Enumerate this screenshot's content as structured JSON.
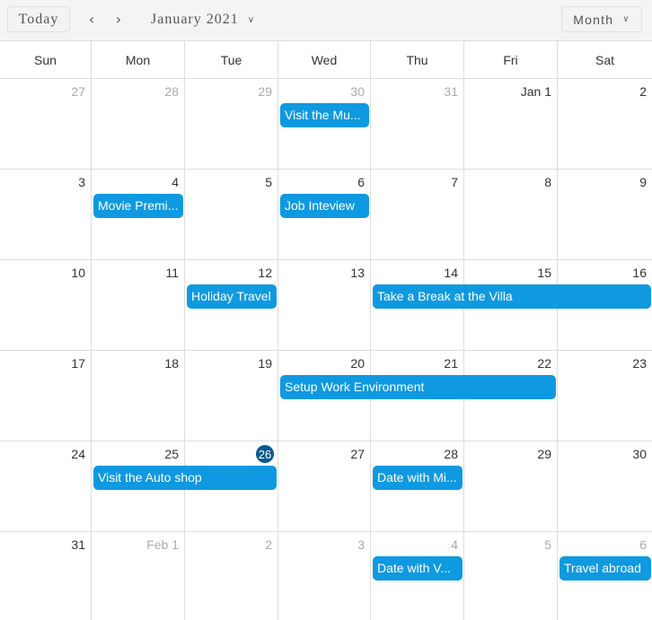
{
  "toolbar": {
    "today_label": "Today",
    "prev_icon": "‹",
    "next_icon": "›",
    "period_label": "January 2021",
    "view_label": "Month",
    "chevron_icon": "⌄"
  },
  "weekdays": [
    "Sun",
    "Mon",
    "Tue",
    "Wed",
    "Thu",
    "Fri",
    "Sat"
  ],
  "weeks": [
    [
      {
        "label": "27",
        "other": true
      },
      {
        "label": "28",
        "other": true
      },
      {
        "label": "29",
        "other": true
      },
      {
        "label": "30",
        "other": true
      },
      {
        "label": "31",
        "other": true
      },
      {
        "label": "Jan 1"
      },
      {
        "label": "2"
      }
    ],
    [
      {
        "label": "3"
      },
      {
        "label": "4"
      },
      {
        "label": "5"
      },
      {
        "label": "6"
      },
      {
        "label": "7"
      },
      {
        "label": "8"
      },
      {
        "label": "9"
      }
    ],
    [
      {
        "label": "10"
      },
      {
        "label": "11"
      },
      {
        "label": "12"
      },
      {
        "label": "13"
      },
      {
        "label": "14"
      },
      {
        "label": "15"
      },
      {
        "label": "16"
      }
    ],
    [
      {
        "label": "17"
      },
      {
        "label": "18"
      },
      {
        "label": "19"
      },
      {
        "label": "20"
      },
      {
        "label": "21"
      },
      {
        "label": "22"
      },
      {
        "label": "23"
      }
    ],
    [
      {
        "label": "24"
      },
      {
        "label": "25"
      },
      {
        "label": "26",
        "today": true
      },
      {
        "label": "27"
      },
      {
        "label": "28"
      },
      {
        "label": "29"
      },
      {
        "label": "30"
      }
    ],
    [
      {
        "label": "31"
      },
      {
        "label": "Feb 1",
        "other": true
      },
      {
        "label": "2",
        "other": true
      },
      {
        "label": "3",
        "other": true
      },
      {
        "label": "4",
        "other": true
      },
      {
        "label": "5",
        "other": true
      },
      {
        "label": "6",
        "other": true
      }
    ]
  ],
  "events": [
    {
      "title": "Visit the Museum",
      "display": "Visit the Mu...",
      "week": 0,
      "start": 3,
      "span": 1
    },
    {
      "title": "Movie Premiere",
      "display": "Movie Premi...",
      "week": 1,
      "start": 1,
      "span": 1
    },
    {
      "title": "Job Inteview",
      "display": "Job Inteview",
      "week": 1,
      "start": 3,
      "span": 1
    },
    {
      "title": "Holiday Travel",
      "display": "Holiday Travel",
      "week": 2,
      "start": 2,
      "span": 1
    },
    {
      "title": "Take a Break at the Villa",
      "display": "Take a Break at the Villa",
      "week": 2,
      "start": 4,
      "span": 3
    },
    {
      "title": "Setup Work Environment",
      "display": "Setup Work Environment",
      "week": 3,
      "start": 3,
      "span": 3
    },
    {
      "title": "Visit the Auto shop",
      "display": "Visit the Auto shop",
      "week": 4,
      "start": 1,
      "span": 2
    },
    {
      "title": "Date with Mi...",
      "display": "Date with Mi...",
      "week": 4,
      "start": 4,
      "span": 1
    },
    {
      "title": "Date with V...",
      "display": "Date with V...",
      "week": 5,
      "start": 4,
      "span": 1
    },
    {
      "title": "Travel abroad",
      "display": "Travel abroad",
      "week": 5,
      "start": 6,
      "span": 1
    }
  ],
  "colors": {
    "event": "#0f99e0",
    "today_badge": "#0b5a8e"
  }
}
